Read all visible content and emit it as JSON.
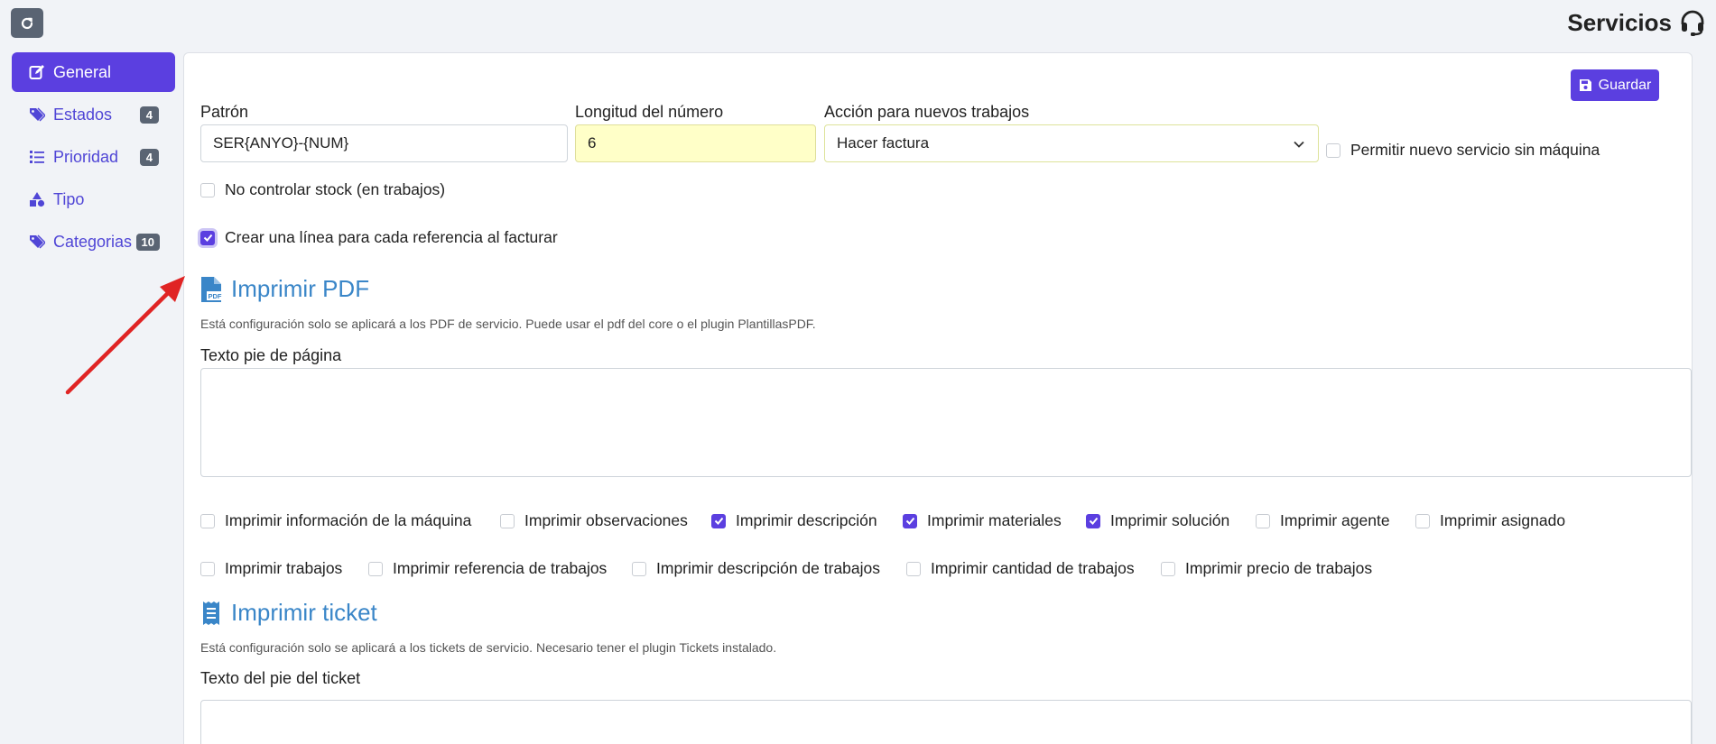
{
  "header": {
    "title": "Servicios",
    "refresh_icon": "refresh-icon",
    "support_icon": "headset-icon"
  },
  "sidebar": {
    "items": [
      {
        "label": "General",
        "icon": "edit-icon",
        "active": true
      },
      {
        "label": "Estados",
        "icon": "tags-icon",
        "badge": "4"
      },
      {
        "label": "Prioridad",
        "icon": "list-ol-icon",
        "badge": "4"
      },
      {
        "label": "Tipo",
        "icon": "shapes-icon"
      },
      {
        "label": "Categorias",
        "icon": "tags-icon",
        "badge": "10"
      }
    ]
  },
  "form": {
    "save_label": "Guardar",
    "pattern_label": "Patrón",
    "pattern_value": "SER{ANYO}-{NUM}",
    "length_label": "Longitud del número",
    "length_value": "6",
    "action_label": "Acción para nuevos trabajos",
    "action_value": "Hacer factura",
    "allow_no_machine": "Permitir nuevo servicio sin máquina",
    "no_stock": "No controlar stock (en trabajos)",
    "one_line_per_ref": "Crear una línea para cada referencia al facturar"
  },
  "pdf": {
    "title": "Imprimir PDF",
    "help": "Está configuración solo se aplicará a los PDF de servicio. Puede usar el pdf del core o el plugin PlantillasPDF.",
    "footer_label": "Texto pie de página",
    "footer_value": "",
    "options_row1": [
      {
        "label": "Imprimir información de la máquina",
        "checked": false
      },
      {
        "label": "Imprimir observaciones",
        "checked": false
      },
      {
        "label": "Imprimir descripción",
        "checked": true
      },
      {
        "label": "Imprimir materiales",
        "checked": true
      },
      {
        "label": "Imprimir solución",
        "checked": true
      },
      {
        "label": "Imprimir agente",
        "checked": false
      },
      {
        "label": "Imprimir asignado",
        "checked": false
      }
    ],
    "options_row2": [
      {
        "label": "Imprimir trabajos",
        "checked": false
      },
      {
        "label": "Imprimir referencia de trabajos",
        "checked": false
      },
      {
        "label": "Imprimir descripción de trabajos",
        "checked": false
      },
      {
        "label": "Imprimir cantidad de trabajos",
        "checked": false
      },
      {
        "label": "Imprimir precio de trabajos",
        "checked": false
      }
    ]
  },
  "ticket": {
    "title": "Imprimir ticket",
    "help": "Está configuración solo se aplicará a los tickets de servicio. Necesario tener el plugin Tickets instalado.",
    "footer_label": "Texto del pie del ticket"
  },
  "colors": {
    "accent": "#5b3fe0",
    "section_title": "#3a86c8",
    "annotation_arrow": "#e02424"
  }
}
